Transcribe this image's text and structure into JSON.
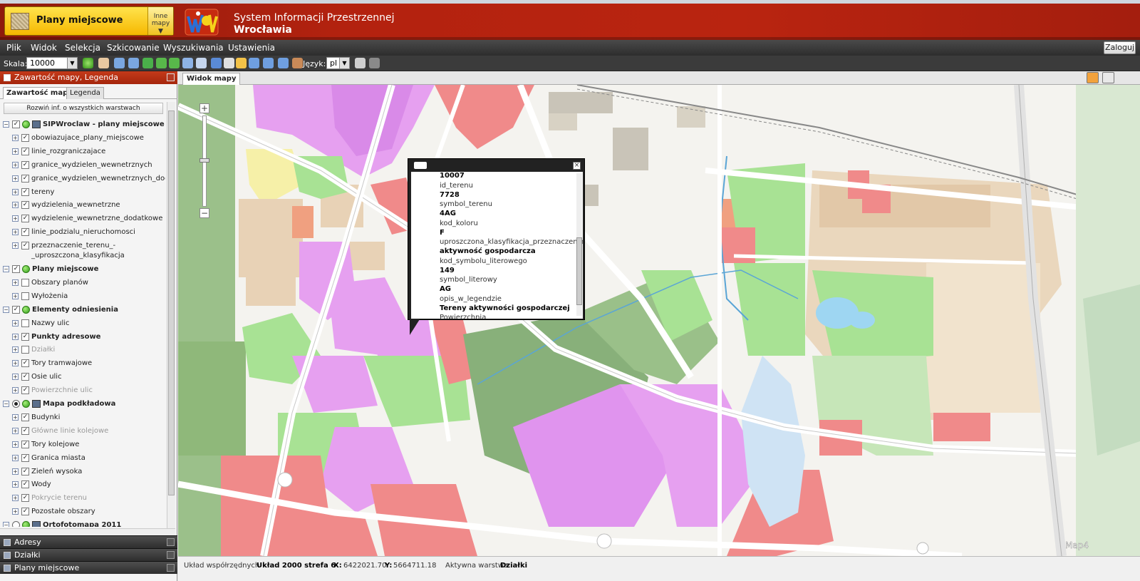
{
  "header": {
    "plans_button_label": "Plany miejscowe",
    "other_maps_label_1": "Inne",
    "other_maps_label_2": "mapy",
    "system_title_1": "System Informacji Przestrzennej",
    "system_title_2": "Wrocławia"
  },
  "menu": {
    "items": [
      "Plik",
      "Widok",
      "Selekcja",
      "Szkicowanie",
      "Wyszukiwania",
      "Ustawienia"
    ],
    "login_label": "Zaloguj"
  },
  "toolbar": {
    "scale_label": "Skala:",
    "scale_value": "10000",
    "language_label": "Język:",
    "language_value": "pl"
  },
  "left_panel": {
    "title": "Zawartość mapy, Legenda",
    "tabs": [
      "Zawartość mapy",
      "Legenda"
    ],
    "expand_all_label": "Rozwiń inf. o wszystkich warstwach",
    "tree": [
      {
        "label": "SIPWroclaw - plany miejscowe",
        "level": 0,
        "bold": true,
        "checked": true,
        "dim": false,
        "kind": "group-wms"
      },
      {
        "label": "obowiazujace_plany_miejscowe",
        "level": 1,
        "checked": true,
        "dim": false
      },
      {
        "label": "linie_rozgraniczajace",
        "level": 1,
        "checked": true,
        "dim": false
      },
      {
        "label": "granice_wydzielen_wewnetrznych",
        "level": 1,
        "checked": true,
        "dim": false
      },
      {
        "label": "granice_wydzielen_wewnetrznych_dodatko",
        "level": 1,
        "checked": true,
        "dim": false
      },
      {
        "label": "tereny",
        "level": 1,
        "checked": true,
        "dim": false
      },
      {
        "label": "wydzielenia_wewnetrzne",
        "level": 1,
        "checked": true,
        "dim": false
      },
      {
        "label": "wydzielenie_wewnetrzne_dodatkowe",
        "level": 1,
        "checked": true,
        "dim": false
      },
      {
        "label": "linie_podzialu_nieruchomosci",
        "level": 1,
        "checked": true,
        "dim": false
      },
      {
        "label": "przeznaczenie_terenu_-",
        "label2": "_uproszczona_klasyfikacja",
        "level": 1,
        "checked": true,
        "dim": false
      },
      {
        "label": "Plany miejscowe",
        "level": 0,
        "bold": true,
        "checked": true,
        "dim": false,
        "kind": "group"
      },
      {
        "label": "Obszary planów",
        "level": 1,
        "checked": false,
        "dim": false
      },
      {
        "label": "Wyłożenia",
        "level": 1,
        "checked": false,
        "dim": false
      },
      {
        "label": "Elementy odniesienia",
        "level": 0,
        "bold": true,
        "checked": true,
        "dim": false,
        "kind": "group"
      },
      {
        "label": "Nazwy ulic",
        "level": 1,
        "checked": false,
        "dim": false
      },
      {
        "label": "Punkty adresowe",
        "level": 1,
        "checked": true,
        "dim": false,
        "bold": true
      },
      {
        "label": "Działki",
        "level": 1,
        "checked": false,
        "dim": true
      },
      {
        "label": "Tory tramwajowe",
        "level": 1,
        "checked": true,
        "dim": false
      },
      {
        "label": "Osie ulic",
        "level": 1,
        "checked": true,
        "dim": false
      },
      {
        "label": "Powierzchnie ulic",
        "level": 1,
        "checked": true,
        "dim": true
      },
      {
        "label": "Mapa podkładowa",
        "level": 0,
        "bold": true,
        "checked": true,
        "dim": false,
        "kind": "radio"
      },
      {
        "label": "Budynki",
        "level": 1,
        "checked": true,
        "dim": false
      },
      {
        "label": "Główne linie kolejowe",
        "level": 1,
        "checked": true,
        "dim": true
      },
      {
        "label": "Tory kolejowe",
        "level": 1,
        "checked": true,
        "dim": false
      },
      {
        "label": "Granica miasta",
        "level": 1,
        "checked": true,
        "dim": false
      },
      {
        "label": "Zieleń wysoka",
        "level": 1,
        "checked": true,
        "dim": false
      },
      {
        "label": "Wody",
        "level": 1,
        "checked": true,
        "dim": false
      },
      {
        "label": "Pokrycie terenu",
        "level": 1,
        "checked": true,
        "dim": true
      },
      {
        "label": "Pozostałe obszary",
        "level": 1,
        "checked": true,
        "dim": false
      },
      {
        "label": "Ortofotomapa 2011",
        "level": 0,
        "bold": true,
        "checked": false,
        "dim": false,
        "kind": "radio-off"
      }
    ],
    "bottom_sections": [
      "Adresy",
      "Działki",
      "Plany miejscowe"
    ]
  },
  "map": {
    "tab_label": "Widok mapy",
    "watermark": "Map4",
    "popup": {
      "rows": [
        {
          "value": "10007"
        },
        {
          "key": "id_terenu",
          "value": "7728"
        },
        {
          "key": "symbol_terenu",
          "value": "4AG"
        },
        {
          "key": "kod_koloru",
          "value": "F"
        },
        {
          "key": "uproszczona_klasyfikacja_przeznaczenia",
          "value": "aktywność gospodarcza"
        },
        {
          "key": "kod_symbolu_literowego",
          "value": "149"
        },
        {
          "key": "symbol_literowy",
          "value": "AG"
        },
        {
          "key": "opis_w_legendzie",
          "value": "Tereny aktywności gospodarczej"
        },
        {
          "key": "Powierzchnia"
        }
      ]
    }
  },
  "statusbar": {
    "crs_label": "Układ współrzędnych",
    "crs_value": "Układ 2000 strefa 6",
    "x_label": "X:",
    "x_value": "6422021.70",
    "y_label": "Y:",
    "y_value": "5664711.18",
    "active_layer_label": "Aktywna warstwa",
    "active_layer_value": "Działki"
  }
}
